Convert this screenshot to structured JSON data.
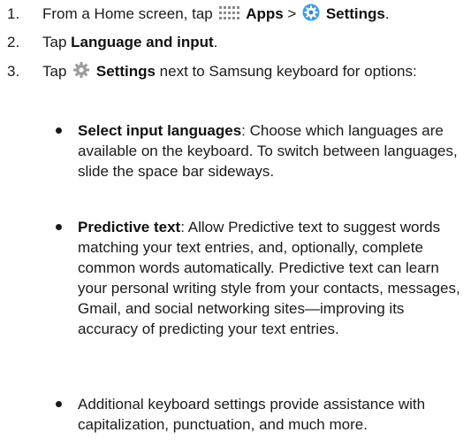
{
  "steps": [
    {
      "number": "1.",
      "pre": "From a Home screen, tap ",
      "apps": "Apps",
      "sep": " > ",
      "settings": "Settings",
      "end": "."
    },
    {
      "number": "2.",
      "pre": "Tap ",
      "bold": "Language and input",
      "end": "."
    },
    {
      "number": "3.",
      "pre": "Tap ",
      "bold": "Settings",
      "post": " next to Samsung keyboard for options:"
    }
  ],
  "bullets": [
    {
      "bold": "Select input languages",
      "text": ": Choose which languages are available on the keyboard. To switch between languages, slide the space bar sideways."
    },
    {
      "bold": "Predictive text",
      "text": ": Allow Predictive text to suggest words matching your text entries, and, optionally, complete common words automatically. Predictive text can learn your personal writing style from your contacts, messages, Gmail, and social networking sites—improving its accuracy of predicting your text entries."
    },
    {
      "text": "Additional keyboard settings provide assistance with capitalization, punctuation, and much more."
    }
  ],
  "icons": {
    "apps": "apps-grid-icon",
    "settings": "settings-gear-icon",
    "gear": "gear-icon"
  },
  "colors": {
    "apps_icon": "#8a8a8a",
    "settings_ring": "#2f7fd6",
    "settings_bg": "#3a9cf0",
    "gear": "#9c9c9c"
  }
}
